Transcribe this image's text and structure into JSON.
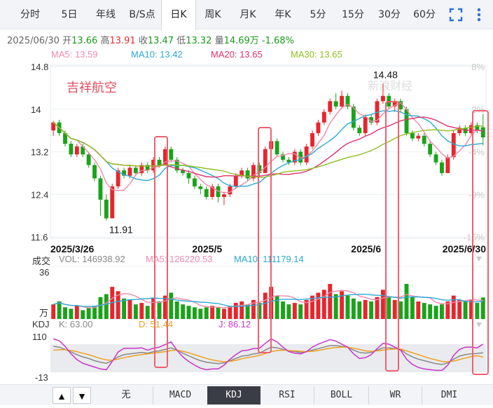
{
  "tabs": [
    {
      "label": "分时",
      "active": false
    },
    {
      "label": "5日",
      "active": false
    },
    {
      "label": "年线",
      "active": false
    },
    {
      "label": "B/S点",
      "active": false
    },
    {
      "label": "日K",
      "active": true
    },
    {
      "label": "周K",
      "active": false
    },
    {
      "label": "月K",
      "active": false
    },
    {
      "label": "年K",
      "active": false
    },
    {
      "label": "5分",
      "active": false
    },
    {
      "label": "15分",
      "active": false
    },
    {
      "label": "30分",
      "active": false
    },
    {
      "label": "60分",
      "active": false
    }
  ],
  "info": {
    "date": "2025/06/30",
    "open_label": "开",
    "open": "13.66",
    "high_label": "高",
    "high": "13.91",
    "close_label": "收",
    "close": "13.47",
    "low_label": "低",
    "low": "13.32",
    "vol_label": "量",
    "vol": "14.69万",
    "change": "-1.68%"
  },
  "ma_legend": [
    {
      "label": "MA5: 13.59",
      "color": "#f08aaa"
    },
    {
      "label": "MA10: 13.42",
      "color": "#2aaad6"
    },
    {
      "label": "MA20: 13.65",
      "color": "#e0306e"
    },
    {
      "label": "MA30: 13.65",
      "color": "#8fbf1f"
    }
  ],
  "stock_name": "吉祥航空",
  "watermark": "新浪财经",
  "vol_legend": {
    "title": "成交",
    "items": [
      {
        "label": "VOL: 146938.92",
        "color": "#888888"
      },
      {
        "label": "MA5: 126220.53",
        "color": "#f08aaa"
      },
      {
        "label": "MA10: 111179.14",
        "color": "#2aaad6"
      }
    ],
    "axis_top": "36",
    "axis_unit": "万"
  },
  "kdj_legend": {
    "title": "KDJ",
    "items": [
      {
        "label": "K: 63.00",
        "color": "#888888"
      },
      {
        "label": "D: 51.44",
        "color": "#f0a020"
      },
      {
        "label": "J: 86.12",
        "color": "#cc33cc"
      }
    ],
    "axis_top": "110",
    "axis_bottom": "-13"
  },
  "indicators": [
    {
      "label": "无",
      "active": false
    },
    {
      "label": "MACD",
      "active": false
    },
    {
      "label": "KDJ",
      "active": true
    },
    {
      "label": "RSI",
      "active": false
    },
    {
      "label": "BOLL",
      "active": false
    },
    {
      "label": "WR",
      "active": false
    },
    {
      "label": "DMI",
      "active": false
    }
  ],
  "chart_data": {
    "type": "candlestick",
    "y_axis_left": [
      "14.8",
      "14",
      "13.2",
      "12.4",
      "11.6"
    ],
    "y_axis_right": [
      "8%",
      "2%",
      "-4%",
      "-9%",
      "-15%"
    ],
    "ylim": [
      11.6,
      14.8
    ],
    "x_labels": [
      "2025/3/26",
      "2025/5",
      "2025/6",
      "2025/6/30"
    ],
    "annotations": {
      "high": "14.48",
      "low": "11.91"
    },
    "candles": [
      [
        13.6,
        13.75,
        13.5,
        13.78
      ],
      [
        13.75,
        13.55,
        13.5,
        13.8
      ],
      [
        13.55,
        13.35,
        13.3,
        13.6
      ],
      [
        13.35,
        13.15,
        13.1,
        13.4
      ],
      [
        13.15,
        13.3,
        13.1,
        13.35
      ],
      [
        13.3,
        13.15,
        13.1,
        13.35
      ],
      [
        13.15,
        12.95,
        12.9,
        13.2
      ],
      [
        12.95,
        12.7,
        12.65,
        13.0
      ],
      [
        12.7,
        12.3,
        12.0,
        12.75
      ],
      [
        12.3,
        11.95,
        11.91,
        12.4
      ],
      [
        11.95,
        12.55,
        11.95,
        12.6
      ],
      [
        12.55,
        12.85,
        12.5,
        12.9
      ],
      [
        12.85,
        12.75,
        12.7,
        12.9
      ],
      [
        12.75,
        12.9,
        12.7,
        12.95
      ],
      [
        12.9,
        12.8,
        12.75,
        12.95
      ],
      [
        12.8,
        12.95,
        12.75,
        13.0
      ],
      [
        12.95,
        12.85,
        12.8,
        13.0
      ],
      [
        12.85,
        13.05,
        12.8,
        13.1
      ],
      [
        13.05,
        12.95,
        12.9,
        13.1
      ],
      [
        12.95,
        13.25,
        12.95,
        13.3
      ],
      [
        13.25,
        13.05,
        13.0,
        13.3
      ],
      [
        13.05,
        12.85,
        12.8,
        13.1
      ],
      [
        12.85,
        12.8,
        12.75,
        12.9
      ],
      [
        12.8,
        12.7,
        12.6,
        12.85
      ],
      [
        12.7,
        12.55,
        12.5,
        12.75
      ],
      [
        12.55,
        12.5,
        12.4,
        12.6
      ],
      [
        12.5,
        12.35,
        12.3,
        12.55
      ],
      [
        12.35,
        12.55,
        12.3,
        12.6
      ],
      [
        12.55,
        12.35,
        12.25,
        12.6
      ],
      [
        12.35,
        12.4,
        12.2,
        12.45
      ],
      [
        12.4,
        12.55,
        12.35,
        12.6
      ],
      [
        12.55,
        12.75,
        12.5,
        12.8
      ],
      [
        12.75,
        12.85,
        12.7,
        12.9
      ],
      [
        12.85,
        12.7,
        12.65,
        12.9
      ],
      [
        12.7,
        12.95,
        12.65,
        13.0
      ],
      [
        12.95,
        12.8,
        12.75,
        13.0
      ],
      [
        12.8,
        13.25,
        12.8,
        13.3
      ],
      [
        13.25,
        13.4,
        13.2,
        13.45
      ],
      [
        13.4,
        13.15,
        13.1,
        13.45
      ],
      [
        13.15,
        13.05,
        13.0,
        13.2
      ],
      [
        13.05,
        13.0,
        12.95,
        13.1
      ],
      [
        13.0,
        13.2,
        12.95,
        13.25
      ],
      [
        13.2,
        13.0,
        12.95,
        13.25
      ],
      [
        13.0,
        13.3,
        12.95,
        13.35
      ],
      [
        13.3,
        13.55,
        13.25,
        13.6
      ],
      [
        13.55,
        13.75,
        13.5,
        13.8
      ],
      [
        13.75,
        13.95,
        13.7,
        14.0
      ],
      [
        13.95,
        14.15,
        13.9,
        14.2
      ],
      [
        14.15,
        14.05,
        14.0,
        14.3
      ],
      [
        14.05,
        14.25,
        14.0,
        14.35
      ],
      [
        14.25,
        14.05,
        14.0,
        14.3
      ],
      [
        14.05,
        13.65,
        13.6,
        14.1
      ],
      [
        13.65,
        13.55,
        13.5,
        13.7
      ],
      [
        13.55,
        13.85,
        13.5,
        13.9
      ],
      [
        13.85,
        13.75,
        13.7,
        13.9
      ],
      [
        13.75,
        14.15,
        13.7,
        14.2
      ],
      [
        14.15,
        14.25,
        14.1,
        14.48
      ],
      [
        14.25,
        14.05,
        14.0,
        14.3
      ],
      [
        14.05,
        14.15,
        13.95,
        14.2
      ],
      [
        14.15,
        14.0,
        13.95,
        14.2
      ],
      [
        14.0,
        13.55,
        13.5,
        14.05
      ],
      [
        13.55,
        13.45,
        13.4,
        13.6
      ],
      [
        13.45,
        13.5,
        13.4,
        13.55
      ],
      [
        13.5,
        13.35,
        13.3,
        13.55
      ],
      [
        13.35,
        13.15,
        13.1,
        13.4
      ],
      [
        13.15,
        13.0,
        12.95,
        13.2
      ],
      [
        13.0,
        12.8,
        12.75,
        13.05
      ],
      [
        12.8,
        13.1,
        12.8,
        13.15
      ],
      [
        13.1,
        13.55,
        13.05,
        13.6
      ],
      [
        13.55,
        13.65,
        13.5,
        13.7
      ],
      [
        13.65,
        13.55,
        13.5,
        13.7
      ],
      [
        13.55,
        13.7,
        13.5,
        13.75
      ],
      [
        13.7,
        13.6,
        13.55,
        13.75
      ],
      [
        13.66,
        13.47,
        13.32,
        13.91
      ]
    ],
    "volume": [
      10,
      12,
      8,
      7,
      9,
      6,
      8,
      9,
      15,
      17,
      22,
      19,
      14,
      13,
      10,
      11,
      9,
      14,
      12,
      16,
      18,
      12,
      10,
      9,
      8,
      7,
      8,
      9,
      8,
      7,
      9,
      11,
      12,
      10,
      13,
      11,
      18,
      22,
      16,
      12,
      10,
      11,
      10,
      13,
      16,
      18,
      20,
      24,
      17,
      19,
      16,
      14,
      12,
      13,
      12,
      15,
      20,
      15,
      13,
      12,
      24,
      15,
      12,
      11,
      10,
      9,
      10,
      12,
      16,
      13,
      12,
      13,
      11,
      14.7
    ],
    "kdj": {
      "k": [
        80,
        78,
        72,
        65,
        58,
        52,
        48,
        42,
        38,
        35,
        42,
        52,
        58,
        60,
        62,
        64,
        62,
        66,
        68,
        72,
        76,
        70,
        62,
        55,
        48,
        42,
        38,
        36,
        34,
        36,
        42,
        48,
        54,
        56,
        60,
        62,
        70,
        78,
        76,
        72,
        68,
        66,
        64,
        66,
        70,
        74,
        78,
        82,
        82,
        80,
        78,
        70,
        64,
        62,
        64,
        70,
        76,
        76,
        74,
        72,
        60,
        52,
        46,
        42,
        38,
        34,
        32,
        36,
        46,
        54,
        58,
        60,
        61,
        63
      ],
      "d": [
        70,
        71,
        71,
        69,
        66,
        62,
        58,
        53,
        48,
        44,
        43,
        46,
        50,
        53,
        56,
        58,
        60,
        62,
        64,
        66,
        69,
        70,
        67,
        63,
        58,
        53,
        48,
        44,
        41,
        39,
        40,
        43,
        47,
        50,
        53,
        56,
        61,
        66,
        69,
        70,
        69,
        68,
        67,
        66,
        67,
        69,
        72,
        75,
        77,
        78,
        78,
        75,
        72,
        68,
        67,
        68,
        70,
        72,
        73,
        73,
        68,
        63,
        58,
        53,
        48,
        44,
        40,
        39,
        41,
        45,
        49,
        53,
        55,
        51.44
      ],
      "j": [
        100,
        95,
        80,
        60,
        45,
        35,
        30,
        25,
        20,
        18,
        40,
        65,
        75,
        75,
        75,
        76,
        70,
        75,
        78,
        85,
        92,
        70,
        52,
        40,
        30,
        22,
        18,
        20,
        20,
        30,
        46,
        58,
        68,
        70,
        74,
        75,
        88,
        100,
        92,
        78,
        66,
        62,
        60,
        66,
        78,
        86,
        92,
        98,
        94,
        86,
        78,
        60,
        48,
        50,
        58,
        74,
        88,
        86,
        78,
        70,
        46,
        32,
        24,
        20,
        18,
        16,
        16,
        30,
        56,
        72,
        78,
        78,
        76,
        86.12
      ]
    }
  }
}
